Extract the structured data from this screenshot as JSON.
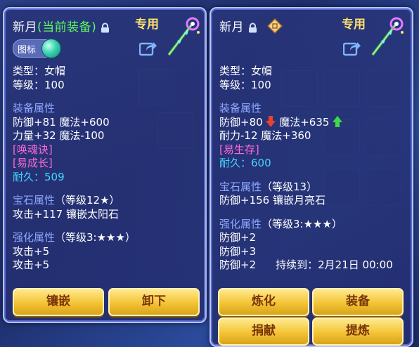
{
  "left_panel": {
    "title": "新月",
    "title_status": "(当前装备)",
    "exclusive_label": "专用",
    "tag_label": "图标",
    "lines": {
      "type": "类型：女帽",
      "level": "等级：100",
      "equip_attr_header": "装备属性",
      "attr1": "防御+81 魔法+600",
      "attr2": "力量+32 魔法-100",
      "special1": "[唤魂诀]",
      "special2": "[易成长]",
      "durability": "耐久：509",
      "gem_header": "宝石属性",
      "gem_level": "（等级12★）",
      "gem_attr": "攻击+117 镶嵌太阳石",
      "enhance_header": "强化属性",
      "enhance_level": "（等级3:★★★）",
      "enh1": "攻击+5",
      "enh2": "攻击+5"
    },
    "buttons": {
      "inlay": "镶嵌",
      "unequip": "卸下"
    }
  },
  "right_panel": {
    "title": "新月",
    "exclusive_label": "专用",
    "lines": {
      "type": "类型：女帽",
      "level": "等级：100",
      "equip_attr_header": "装备属性",
      "attr1_a": "防御+80",
      "attr1_b": "魔法+635",
      "attr2": "耐力-12 魔法+360",
      "special1": "[易生存]",
      "durability": "耐久：600",
      "gem_header": "宝石属性",
      "gem_level": "（等级13）",
      "gem_attr": "防御+156 镶嵌月亮石",
      "enhance_header": "强化属性",
      "enhance_level": "（等级3:★★★）",
      "enh1": "防御+2",
      "enh2": "防御+3",
      "enh3": "防御+2",
      "duration": "持续到：2月21日 00:00"
    },
    "buttons": {
      "refine": "炼化",
      "equip": "装备",
      "donate": "捐献",
      "extract": "提炼"
    }
  },
  "colors": {
    "green": "#5dff5d",
    "section": "#8ea8ff",
    "pink": "#ff6ad5",
    "cyan": "#45d6ff",
    "gold": "#ffe36a"
  },
  "icons": [
    "lock-icon",
    "staff-icon",
    "share-icon",
    "seal-icon",
    "arrow-down-icon",
    "arrow-up-icon"
  ]
}
